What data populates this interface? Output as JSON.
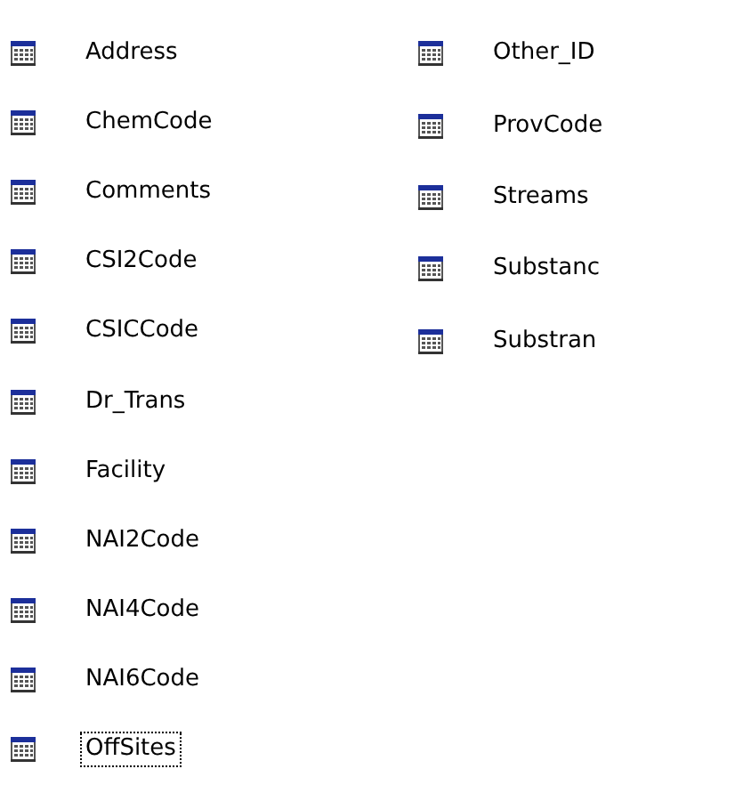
{
  "columns": [
    {
      "items": [
        {
          "label": "Address",
          "focused": false
        },
        {
          "label": "ChemCode",
          "focused": false
        },
        {
          "label": "Comments",
          "focused": false
        },
        {
          "label": "CSI2Code",
          "focused": false
        },
        {
          "label": "CSICCode",
          "focused": false
        },
        {
          "label": "Dr_Trans",
          "focused": false
        },
        {
          "label": "Facility",
          "focused": false
        },
        {
          "label": "NAI2Code",
          "focused": false
        },
        {
          "label": "NAI4Code",
          "focused": false
        },
        {
          "label": "NAI6Code",
          "focused": false
        },
        {
          "label": "OffSites",
          "focused": true
        }
      ]
    },
    {
      "items": [
        {
          "label": "Other_ID",
          "focused": false
        },
        {
          "label": "ProvCode",
          "focused": false
        },
        {
          "label": "Streams",
          "focused": false
        },
        {
          "label": "Substanc",
          "focused": false
        },
        {
          "label": "Substran",
          "focused": false
        }
      ]
    }
  ]
}
